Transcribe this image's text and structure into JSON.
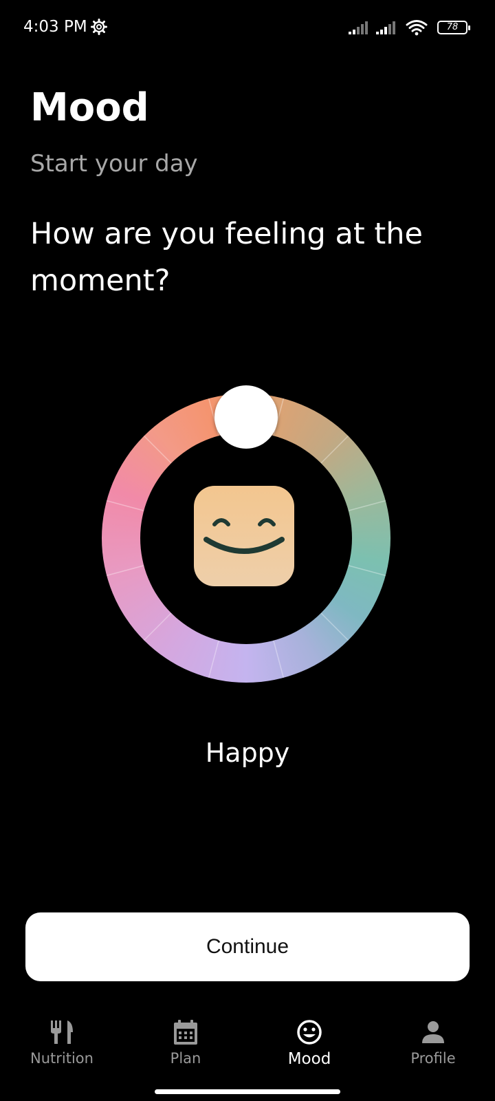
{
  "status_bar": {
    "time": "4:03 PM",
    "battery": "78",
    "icons": [
      "settings-gear-icon",
      "signal-icon",
      "signal-icon",
      "wifi-icon",
      "battery-icon"
    ]
  },
  "header": {
    "title": "Mood",
    "subtitle": "Start your day"
  },
  "question": "How are you feeling at the moment?",
  "mood_wheel": {
    "selected_mood": "Happy",
    "face_icon": "happy-face-icon",
    "knob_position_deg": 0
  },
  "actions": {
    "continue_label": "Continue"
  },
  "bottom_nav": {
    "items": [
      {
        "label": "Nutrition",
        "icon": "fork-knife-icon",
        "active": false
      },
      {
        "label": "Plan",
        "icon": "calendar-icon",
        "active": false
      },
      {
        "label": "Mood",
        "icon": "smiley-icon",
        "active": true
      },
      {
        "label": "Profile",
        "icon": "person-icon",
        "active": false
      }
    ]
  },
  "colors": {
    "background": "#000000",
    "text_primary": "#ffffff",
    "text_secondary": "#a8a8a8",
    "nav_inactive": "#9a9a9a",
    "face": "#f3c68f",
    "face_features": "#1f3a33"
  }
}
